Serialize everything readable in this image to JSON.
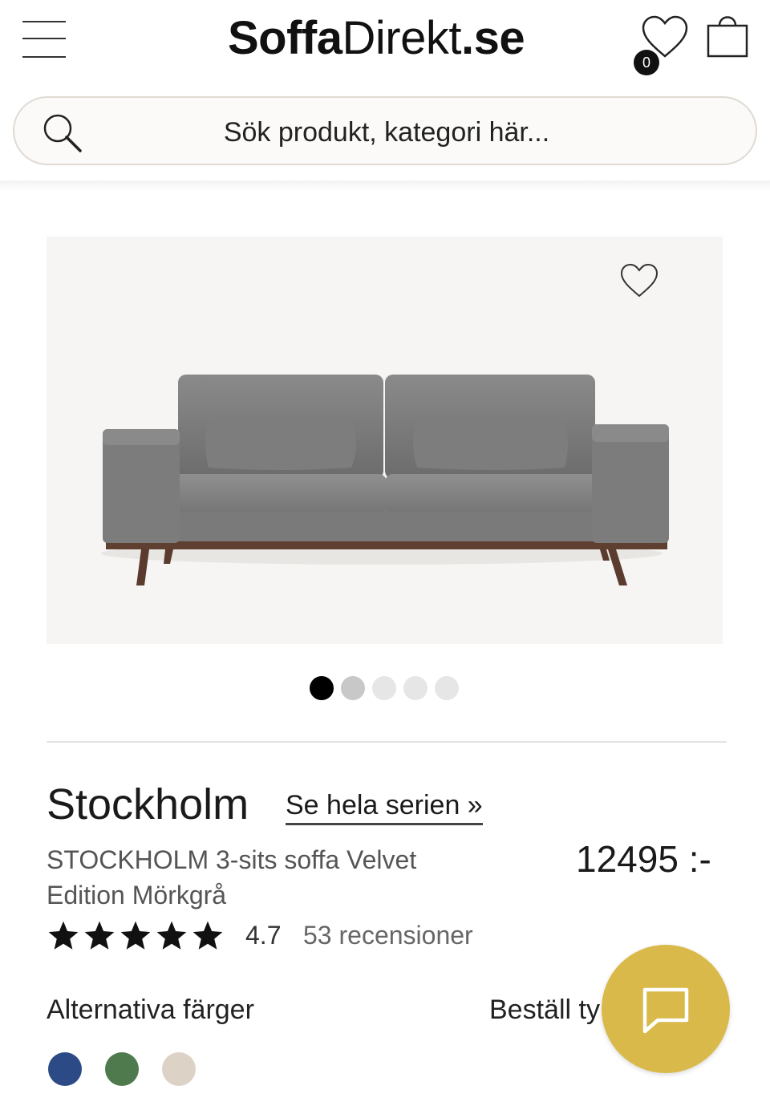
{
  "header": {
    "logo_part1": "Soffa",
    "logo_part2": "Direkt",
    "logo_part3": ".se",
    "wishlist_count": "0",
    "menu_icon": "hamburger-menu-icon",
    "wishlist_icon": "heart-icon",
    "cart_icon": "shopping-bag-icon"
  },
  "search": {
    "placeholder": "Sök produkt, kategori här...",
    "icon": "search-icon"
  },
  "gallery": {
    "image_count": 5,
    "active_index": 0,
    "favorite_icon": "heart-outline-icon"
  },
  "product": {
    "title": "Stockholm",
    "series_link": "Se hela serien »",
    "subtitle": "STOCKHOLM 3-sits soffa Velvet Edition Mörkgrå",
    "price": "12495 :-",
    "rating_value": "4.7",
    "stars": 5,
    "reviews": "53 recensioner",
    "alt_colors_label": "Alternativa färger",
    "order_label": "Beställ ty",
    "swatches": [
      "#2b4a86",
      "#4e7a4e",
      "#dcd3c6"
    ]
  },
  "chat": {
    "icon": "chat-bubble-icon",
    "color": "#d9b949"
  }
}
